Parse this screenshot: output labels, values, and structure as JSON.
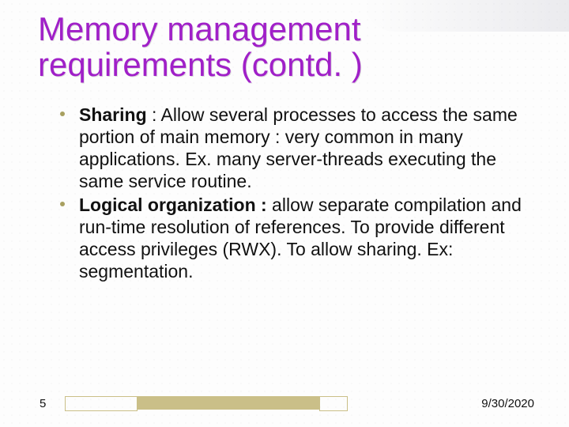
{
  "title": "Memory management requirements (contd. )",
  "bullets": [
    {
      "lead": "Sharing",
      "rest": " : Allow several processes to access the same portion of main memory : very common in many applications. Ex. many server-threads executing the same service routine."
    },
    {
      "lead": "Logical organization :",
      "rest": " allow separate compilation and run-time resolution of references. To provide different access privileges (RWX). To allow sharing. Ex: segmentation."
    }
  ],
  "page_number": "5",
  "date": "9/30/2020"
}
